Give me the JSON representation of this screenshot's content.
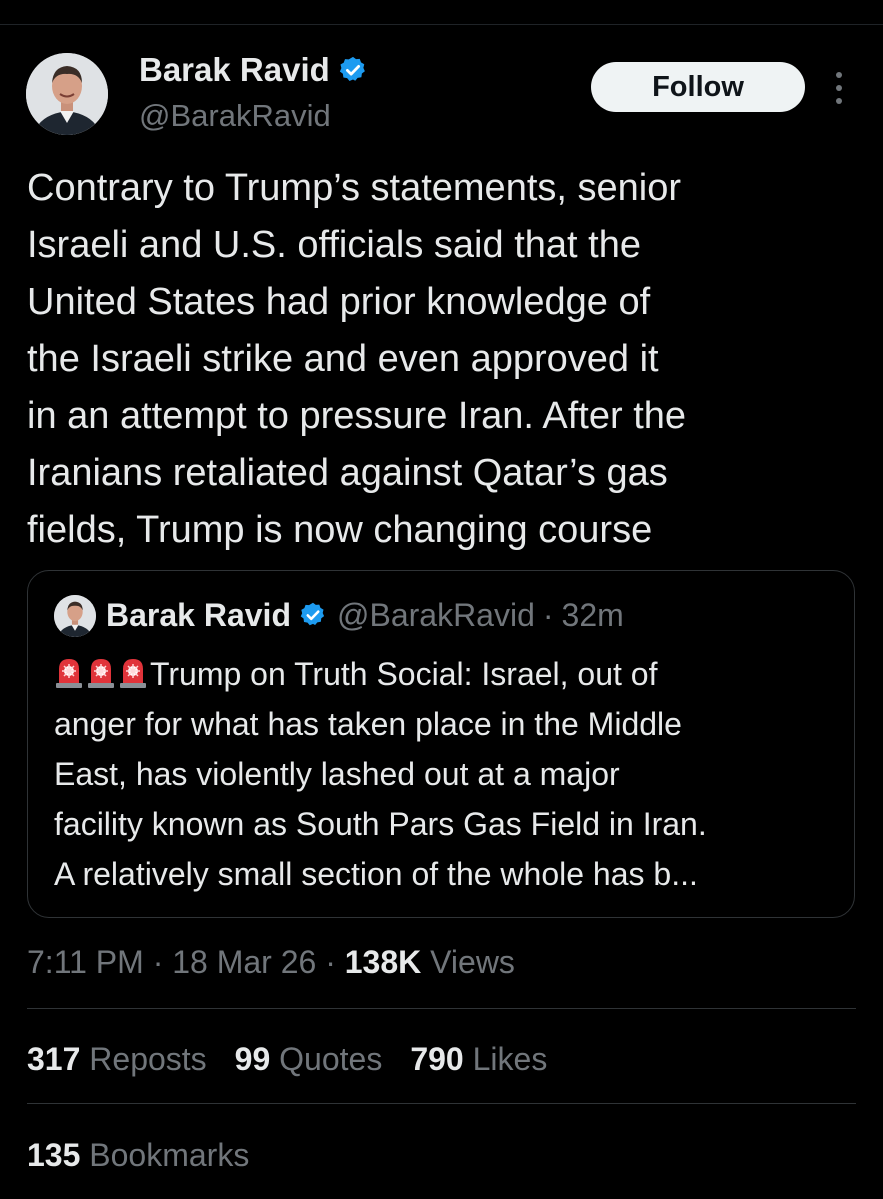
{
  "author": {
    "name": "Barak Ravid",
    "handle": "@BarakRavid",
    "verified_color": "#1d9bf0"
  },
  "follow_label": "Follow",
  "tweet": {
    "text": "Contrary to Trump’s statements, senior\nIsraeli and U.S. officials said that the\nUnited States had prior knowledge of\nthe Israeli strike and even approved it\nin an attempt to pressure Iran. After the\nIranians retaliated against Qatar’s gas\nfields, Trump is now changing course"
  },
  "quoted": {
    "name": "Barak Ravid",
    "handle": "@BarakRavid",
    "separator": "·",
    "time": "32m",
    "emoji": "siren-emoji x3",
    "text": "Trump on Truth Social: Israel, out of\nanger for what has taken place in the Middle\nEast, has violently lashed out at a major\nfacility known as South Pars Gas Field in Iran.\nA relatively small section of the whole has b..."
  },
  "meta": {
    "time": "7:11 PM",
    "date": "18 Mar 26",
    "views_count": "138K",
    "views_label": "Views",
    "separator": "·"
  },
  "stats": [
    {
      "count": "317",
      "label": "Reposts"
    },
    {
      "count": "99",
      "label": "Quotes"
    },
    {
      "count": "790",
      "label": "Likes"
    }
  ],
  "bookmarks": {
    "count": "135",
    "label": "Bookmarks"
  }
}
